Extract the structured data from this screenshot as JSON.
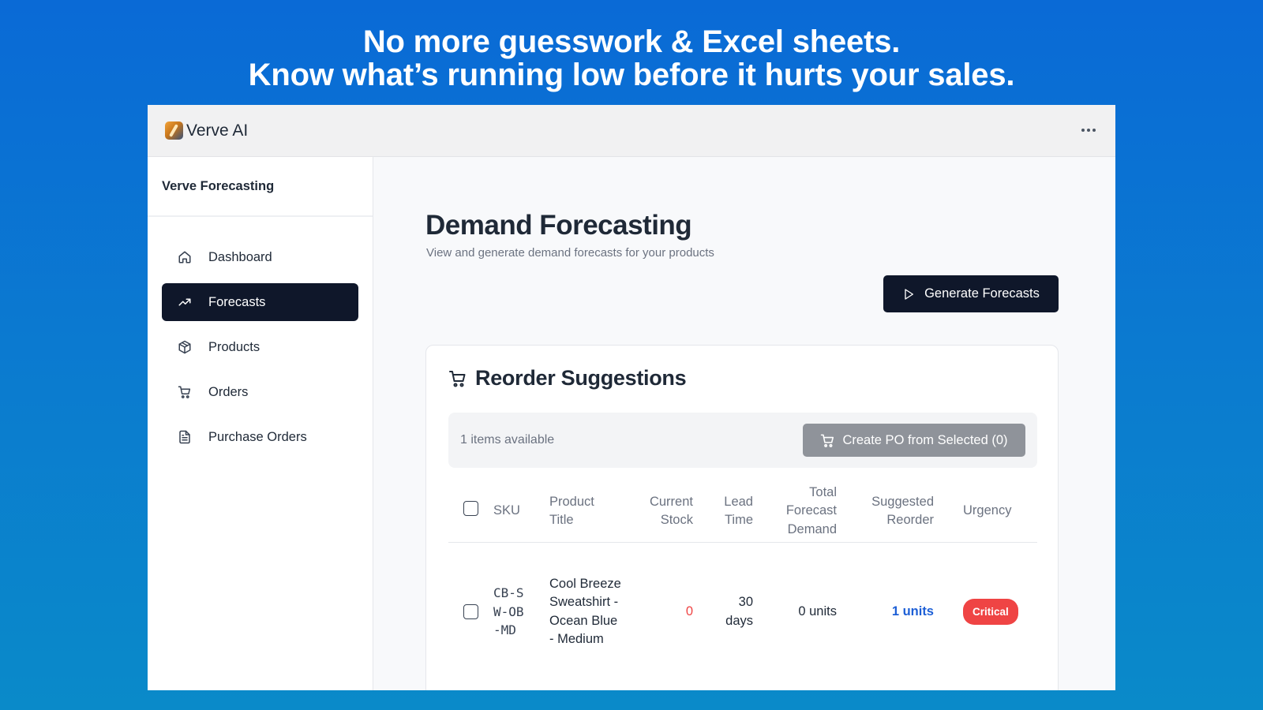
{
  "hero": {
    "line1": "No more guesswork & Excel sheets.",
    "line2": "Know what’s running low before it hurts your sales."
  },
  "app": {
    "name": "Verve AI",
    "more_icon": "more-horizontal-icon"
  },
  "sidebar": {
    "title": "Verve Forecasting",
    "items": [
      {
        "label": "Dashboard",
        "icon": "home-icon",
        "active": false
      },
      {
        "label": "Forecasts",
        "icon": "trending-up-icon",
        "active": true
      },
      {
        "label": "Products",
        "icon": "package-icon",
        "active": false
      },
      {
        "label": "Orders",
        "icon": "cart-icon",
        "active": false
      },
      {
        "label": "Purchase Orders",
        "icon": "document-icon",
        "active": false
      }
    ]
  },
  "main": {
    "title": "Demand Forecasting",
    "subtitle": "View and generate demand forecasts for your products",
    "generate_button": "Generate Forecasts"
  },
  "reorder": {
    "title": "Reorder Suggestions",
    "items_count": "1 items available",
    "create_po_button": "Create PO from Selected (0)",
    "columns": {
      "sku": "SKU",
      "product_title": "Product Title",
      "current_stock": "Current Stock",
      "lead_time": "Lead Time",
      "total_forecast_demand": "Total Forecast Demand",
      "suggested_reorder": "Suggested Reorder",
      "urgency": "Urgency"
    },
    "rows": [
      {
        "sku": "CB-SW-OB-MD",
        "product_title": "Cool Breeze Sweatshirt - Ocean Blue - Medium",
        "current_stock": "0",
        "lead_time": "30 days",
        "total_forecast_demand": "0 units",
        "suggested_reorder": "1 units",
        "urgency": "Critical"
      }
    ]
  },
  "colors": {
    "background_top": "#0a6ad6",
    "nav_active": "#0f172a",
    "critical": "#ef4444",
    "link": "#1d5fd6"
  }
}
